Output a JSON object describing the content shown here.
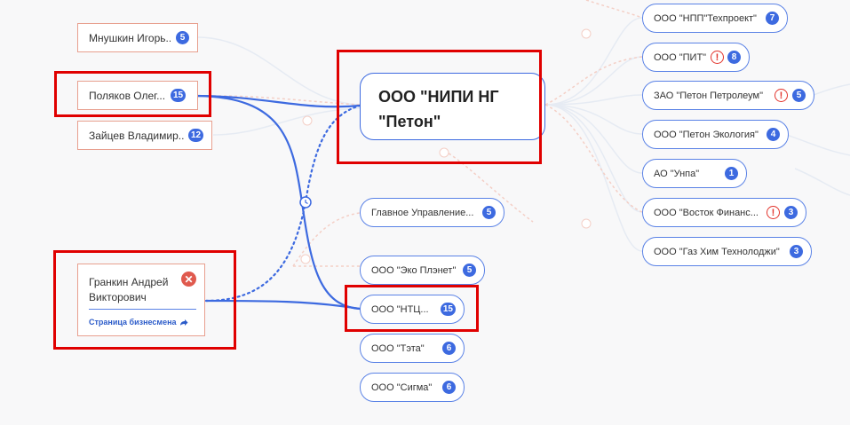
{
  "people": {
    "mnushkin": {
      "name": "Мнушкин Игорь...",
      "count": "5"
    },
    "polyakov": {
      "name": "Поляков Олег...",
      "count": "15"
    },
    "zaitsev": {
      "name": "Зайцев Владимир...",
      "count": "12"
    },
    "grankin": {
      "name_line1": "Гранкин Андрей",
      "name_line2": "Викторович",
      "link_label": "Страница бизнесмена",
      "link_icon": "share-arrow-icon",
      "close_icon": "close-icon"
    }
  },
  "main_company": {
    "line1": "ООО \"НИПИ НГ",
    "line2": "\"Петон\""
  },
  "companies_middle": [
    {
      "name": "Главное Управление...",
      "count": "5"
    },
    {
      "name": "ООО \"Эко Плэнет\"",
      "count": "5"
    },
    {
      "name": "ООО \"НТЦ...",
      "count": "15"
    },
    {
      "name": "ООО \"Тэта\"",
      "count": "6"
    },
    {
      "name": "ООО \"Сигма\"",
      "count": "6"
    }
  ],
  "companies_right": [
    {
      "name": "ООО \"НПП\"Техпроект\"",
      "count": "7",
      "warning": false
    },
    {
      "name": "ООО \"ПИТ\"",
      "count": "8",
      "warning": true
    },
    {
      "name": "ЗАО \"Петон Петролеум\"",
      "count": "5",
      "warning": true
    },
    {
      "name": "ООО \"Петон Экология\"",
      "count": "4",
      "warning": false
    },
    {
      "name": "АО \"Унпа\"",
      "count": "1",
      "warning": false
    },
    {
      "name": "ООО \"Восток Финанс...",
      "count": "3",
      "warning": true
    },
    {
      "name": "ООО \"Газ Хим Технолоджи\"",
      "count": "3",
      "warning": false
    }
  ],
  "icons": {
    "warning": "!",
    "clock": "clock-icon"
  },
  "colors": {
    "link_blue": "#3d6ae0",
    "person_border": "#e8a08f",
    "warning_red": "#e2332b",
    "highlight_red": "#e00000"
  }
}
